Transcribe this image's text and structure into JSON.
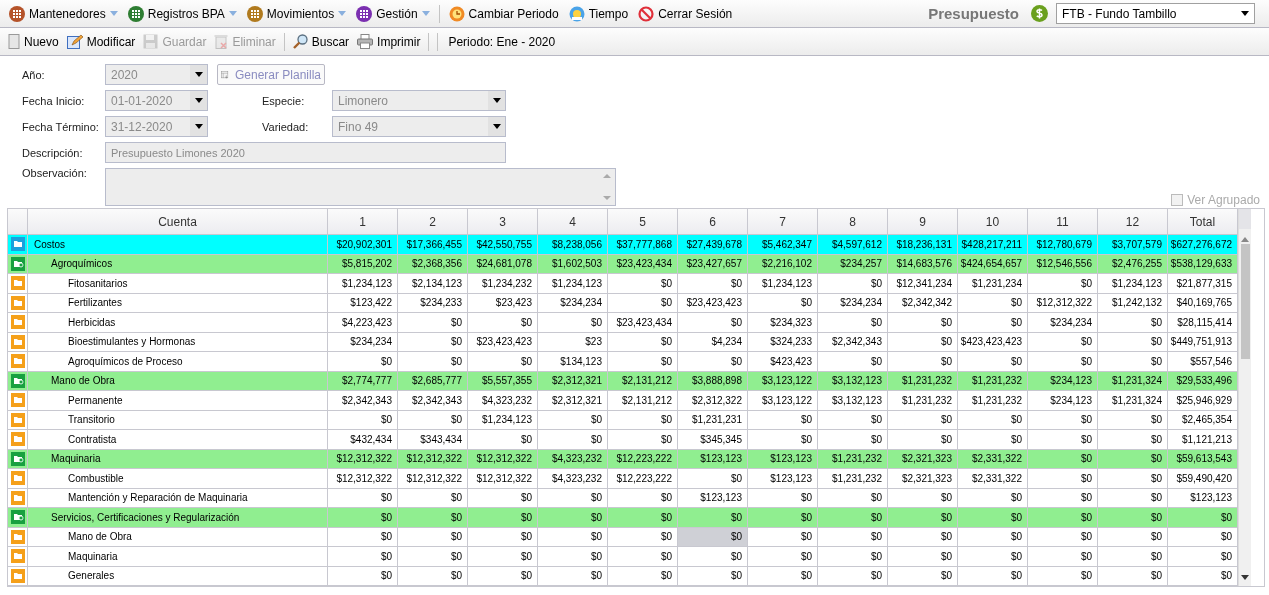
{
  "menu_bar": {
    "items": [
      {
        "label": "Mantenedores",
        "kind": "menu",
        "color": "#b5532a"
      },
      {
        "label": "Registros BPA",
        "kind": "menu",
        "color": "#2e7d32"
      },
      {
        "label": "Movimientos",
        "kind": "menu",
        "color": "#b07a1e"
      },
      {
        "label": "Gestión",
        "kind": "menu",
        "color": "#7b2fb0"
      },
      {
        "label": "Cambiar Periodo",
        "kind": "clock"
      },
      {
        "label": "Tiempo",
        "kind": "weather"
      },
      {
        "label": "Cerrar Sesión",
        "kind": "logout"
      }
    ],
    "module_title": "Presupuesto",
    "farm_select": {
      "value": "FTB - Fundo Tambillo"
    }
  },
  "toolbar": {
    "items": [
      {
        "label": "Nuevo",
        "kind": "new",
        "disabled": false
      },
      {
        "label": "Modificar",
        "kind": "edit",
        "disabled": false
      },
      {
        "label": "Guardar",
        "kind": "save",
        "disabled": true
      },
      {
        "label": "Eliminar",
        "kind": "delete",
        "disabled": true
      },
      {
        "label": "Buscar",
        "kind": "search",
        "disabled": false
      },
      {
        "label": "Imprimir",
        "kind": "print",
        "disabled": false
      }
    ],
    "period": "Periodo: Ene - 2020"
  },
  "form": {
    "year": {
      "label": "Año:",
      "value": "2020"
    },
    "generate_button": "Generar Planilla",
    "start_date": {
      "label": "Fecha Inicio:",
      "value": "01-01-2020"
    },
    "end_date": {
      "label": "Fecha Término:",
      "value": "31-12-2020"
    },
    "species": {
      "label": "Especie:",
      "value": "Limonero"
    },
    "variety": {
      "label": "Variedad:",
      "value": "Fino 49"
    },
    "description": {
      "label": "Descripción:",
      "value": "Presupuesto Limones 2020"
    },
    "observation": {
      "label": "Observación:"
    },
    "grouped": {
      "label": "Ver Agrupado",
      "checked": false
    }
  },
  "grid": {
    "columns": [
      "Cuenta",
      "1",
      "2",
      "3",
      "4",
      "5",
      "6",
      "7",
      "8",
      "9",
      "10",
      "11",
      "12",
      "Total"
    ],
    "rows": [
      {
        "label": "Costos",
        "kind": "root",
        "values": [
          "$20,902,301",
          "$17,366,455",
          "$42,550,755",
          "$8,238,056",
          "$37,777,868",
          "$27,439,678",
          "$5,462,347",
          "$4,597,612",
          "$18,236,131",
          "$428,217,211",
          "$12,780,679",
          "$3,707,579",
          "$627,276,672"
        ],
        "children": [
          {
            "label": "Agroquímicos",
            "kind": "group",
            "values": [
              "$5,815,202",
              "$2,368,356",
              "$24,681,078",
              "$1,602,503",
              "$23,423,434",
              "$23,427,657",
              "$2,216,102",
              "$234,257",
              "$14,683,576",
              "$424,654,657",
              "$12,546,556",
              "$2,476,255",
              "$538,129,633"
            ],
            "children": [
              {
                "label": "Fitosanitarios",
                "kind": "item",
                "values": [
                  "$1,234,123",
                  "$2,134,123",
                  "$1,234,232",
                  "$1,234,123",
                  "$0",
                  "$0",
                  "$1,234,123",
                  "$0",
                  "$12,341,234",
                  "$1,231,234",
                  "$0",
                  "$1,234,123",
                  "$21,877,315"
                ]
              },
              {
                "label": "Fertilizantes",
                "kind": "item",
                "values": [
                  "$123,422",
                  "$234,233",
                  "$23,423",
                  "$234,234",
                  "$0",
                  "$23,423,423",
                  "$0",
                  "$234,234",
                  "$2,342,342",
                  "$0",
                  "$12,312,322",
                  "$1,242,132",
                  "$40,169,765"
                ]
              },
              {
                "label": "Herbicidas",
                "kind": "item",
                "values": [
                  "$4,223,423",
                  "$0",
                  "$0",
                  "$0",
                  "$23,423,434",
                  "$0",
                  "$234,323",
                  "$0",
                  "$0",
                  "$0",
                  "$234,234",
                  "$0",
                  "$28,115,414"
                ]
              },
              {
                "label": "Bioestimulantes y Hormonas",
                "kind": "item",
                "values": [
                  "$234,234",
                  "$0",
                  "$23,423,423",
                  "$23",
                  "$0",
                  "$4,234",
                  "$324,233",
                  "$2,342,343",
                  "$0",
                  "$423,423,423",
                  "$0",
                  "$0",
                  "$449,751,913"
                ]
              },
              {
                "label": "Agroquímicos de Proceso",
                "kind": "item",
                "values": [
                  "$0",
                  "$0",
                  "$0",
                  "$134,123",
                  "$0",
                  "$0",
                  "$423,423",
                  "$0",
                  "$0",
                  "$0",
                  "$0",
                  "$0",
                  "$557,546"
                ]
              }
            ]
          },
          {
            "label": "Mano de Obra",
            "kind": "group",
            "values": [
              "$2,774,777",
              "$2,685,777",
              "$5,557,355",
              "$2,312,321",
              "$2,131,212",
              "$3,888,898",
              "$3,123,122",
              "$3,132,123",
              "$1,231,232",
              "$1,231,232",
              "$234,123",
              "$1,231,324",
              "$29,533,496"
            ],
            "children": [
              {
                "label": "Permanente",
                "kind": "item",
                "values": [
                  "$2,342,343",
                  "$2,342,343",
                  "$4,323,232",
                  "$2,312,321",
                  "$2,131,212",
                  "$2,312,322",
                  "$3,123,122",
                  "$3,132,123",
                  "$1,231,232",
                  "$1,231,232",
                  "$234,123",
                  "$1,231,324",
                  "$25,946,929"
                ]
              },
              {
                "label": "Transitorio",
                "kind": "item",
                "values": [
                  "$0",
                  "$0",
                  "$1,234,123",
                  "$0",
                  "$0",
                  "$1,231,231",
                  "$0",
                  "$0",
                  "$0",
                  "$0",
                  "$0",
                  "$0",
                  "$2,465,354"
                ]
              },
              {
                "label": "Contratista",
                "kind": "item",
                "values": [
                  "$432,434",
                  "$343,434",
                  "$0",
                  "$0",
                  "$0",
                  "$345,345",
                  "$0",
                  "$0",
                  "$0",
                  "$0",
                  "$0",
                  "$0",
                  "$1,121,213"
                ]
              }
            ]
          },
          {
            "label": "Maquinaria",
            "kind": "group",
            "values": [
              "$12,312,322",
              "$12,312,322",
              "$12,312,322",
              "$4,323,232",
              "$12,223,222",
              "$123,123",
              "$123,123",
              "$1,231,232",
              "$2,321,323",
              "$2,331,322",
              "$0",
              "$0",
              "$59,613,543"
            ],
            "children": [
              {
                "label": "Combustible",
                "kind": "item",
                "values": [
                  "$12,312,322",
                  "$12,312,322",
                  "$12,312,322",
                  "$4,323,232",
                  "$12,223,222",
                  "$0",
                  "$123,123",
                  "$1,231,232",
                  "$2,321,323",
                  "$2,331,322",
                  "$0",
                  "$0",
                  "$59,490,420"
                ]
              },
              {
                "label": "Mantención y Reparación de Maquinaria",
                "kind": "item",
                "values": [
                  "$0",
                  "$0",
                  "$0",
                  "$0",
                  "$0",
                  "$123,123",
                  "$0",
                  "$0",
                  "$0",
                  "$0",
                  "$0",
                  "$0",
                  "$123,123"
                ]
              }
            ]
          },
          {
            "label": "Servicios, Certificaciones y Regularización",
            "kind": "group",
            "values": [
              "$0",
              "$0",
              "$0",
              "$0",
              "$0",
              "$0",
              "$0",
              "$0",
              "$0",
              "$0",
              "$0",
              "$0",
              "$0"
            ],
            "children": [
              {
                "label": "Mano de Obra",
                "kind": "item",
                "selected_cells": [
                  false,
                  false,
                  false,
                  false,
                  false,
                  true,
                  false,
                  false,
                  false,
                  false,
                  false,
                  false,
                  false
                ],
                "values": [
                  "$0",
                  "$0",
                  "$0",
                  "$0",
                  "$0",
                  "$0",
                  "$0",
                  "$0",
                  "$0",
                  "$0",
                  "$0",
                  "$0",
                  "$0"
                ]
              },
              {
                "label": "Maquinaria",
                "kind": "item",
                "values": [
                  "$0",
                  "$0",
                  "$0",
                  "$0",
                  "$0",
                  "$0",
                  "$0",
                  "$0",
                  "$0",
                  "$0",
                  "$0",
                  "$0",
                  "$0"
                ]
              },
              {
                "label": "Generales",
                "kind": "item",
                "values": [
                  "$0",
                  "$0",
                  "$0",
                  "$0",
                  "$0",
                  "$0",
                  "$0",
                  "$0",
                  "$0",
                  "$0",
                  "$0",
                  "$0",
                  "$0"
                ]
              }
            ]
          }
        ]
      }
    ]
  }
}
